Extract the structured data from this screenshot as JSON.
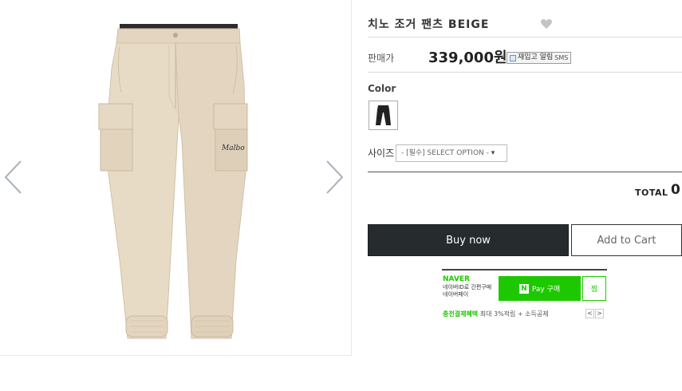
{
  "product": {
    "title": "치노 조거 팬츠 BEIGE",
    "price_label": "판매가",
    "price": "339,000원",
    "restock_label": "재입고 알림",
    "restock_sms": "SMS",
    "color_label": "Color",
    "size_label": "사이즈",
    "size_option": "- [필수] SELECT OPTION -",
    "total_label": "TOTAL",
    "total_value": "0"
  },
  "buttons": {
    "buy_now": "Buy now",
    "add_to_cart": "Add to Cart"
  },
  "npay": {
    "naver": "NAVER",
    "desc_line1": "네이버ID로 간편구매",
    "desc_line2": "네이버페이",
    "pay_label": "Pay 구매",
    "n_logo": "N",
    "zzim": "찜",
    "promo_green": "충전결제혜택",
    "promo_gray": "최대 3%적립 + 소득공제",
    "nav_prev": "<",
    "nav_next": ">"
  },
  "colors": {
    "product_beige": "#e6d8c2",
    "buy_button": "#262b2e",
    "naver_green": "#1ec800"
  },
  "icons": {
    "prev": "chevron-left-icon",
    "next": "chevron-right-icon",
    "wishlist": "heart-icon"
  }
}
